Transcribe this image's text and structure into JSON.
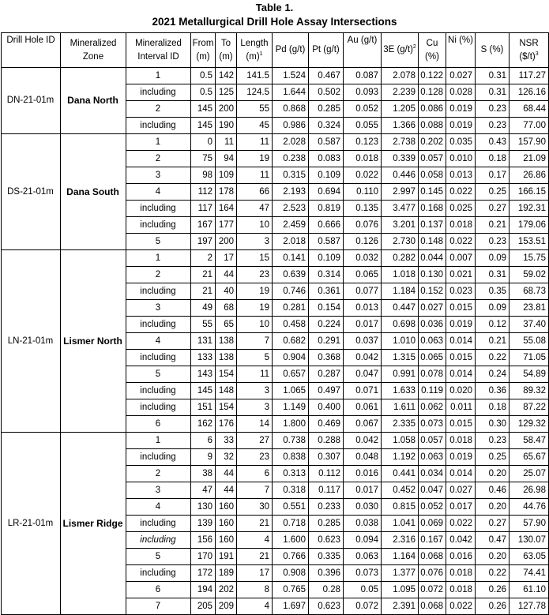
{
  "title_line1": "Table 1.",
  "title_line2": "2021 Metallurgical Drill Hole Assay Intersections",
  "headers": {
    "hole": "Drill Hole ID",
    "zone": "Mineralized Zone",
    "interval": "Mineralized Interval ID",
    "from": "From (m)",
    "to": "To (m)",
    "length": "Length (m)",
    "length_sup": "1",
    "pd": "Pd (g/t)",
    "pt": "Pt (g/t)",
    "au": "Au (g/t)",
    "e3": "3E (g/t)",
    "e3_sup": "2",
    "cu": "Cu (%)",
    "ni": "Ni (%)",
    "s": "S (%)",
    "nsr": "NSR ($/t)",
    "nsr_sup": "3"
  },
  "groups": [
    {
      "hole": "DN-21-01m",
      "zone": "Dana North",
      "rows": [
        [
          "1",
          "0.5",
          "142",
          "141.5",
          "1.524",
          "0.467",
          "0.087",
          "2.078",
          "0.122",
          "0.027",
          "0.31",
          "117.27"
        ],
        [
          "including",
          "0.5",
          "125",
          "124.5",
          "1.644",
          "0.502",
          "0.093",
          "2.239",
          "0.128",
          "0.028",
          "0.31",
          "126.16"
        ],
        [
          "2",
          "145",
          "200",
          "55",
          "0.868",
          "0.285",
          "0.052",
          "1.205",
          "0.086",
          "0.019",
          "0.23",
          "68.44"
        ],
        [
          "including",
          "145",
          "190",
          "45",
          "0.986",
          "0.324",
          "0.055",
          "1.366",
          "0.088",
          "0.019",
          "0.23",
          "77.00"
        ]
      ]
    },
    {
      "hole": "DS-21-01m",
      "zone": "Dana South",
      "rows": [
        [
          "1",
          "0",
          "11",
          "11",
          "2.028",
          "0.587",
          "0.123",
          "2.738",
          "0.202",
          "0.035",
          "0.43",
          "157.90"
        ],
        [
          "2",
          "75",
          "94",
          "19",
          "0.238",
          "0.083",
          "0.018",
          "0.339",
          "0.057",
          "0.010",
          "0.18",
          "21.09"
        ],
        [
          "3",
          "98",
          "109",
          "11",
          "0.315",
          "0.109",
          "0.022",
          "0.446",
          "0.058",
          "0.013",
          "0.17",
          "26.86"
        ],
        [
          "4",
          "112",
          "178",
          "66",
          "2.193",
          "0.694",
          "0.110",
          "2.997",
          "0.145",
          "0.022",
          "0.25",
          "166.15"
        ],
        [
          "including",
          "117",
          "164",
          "47",
          "2.523",
          "0.819",
          "0.135",
          "3.477",
          "0.168",
          "0.025",
          "0.27",
          "192.31"
        ],
        [
          "including",
          "167",
          "177",
          "10",
          "2.459",
          "0.666",
          "0.076",
          "3.201",
          "0.137",
          "0.018",
          "0.21",
          "179.06"
        ],
        [
          "5",
          "197",
          "200",
          "3",
          "2.018",
          "0.587",
          "0.126",
          "2.730",
          "0.148",
          "0.022",
          "0.23",
          "153.51"
        ]
      ]
    },
    {
      "hole": "LN-21-01m",
      "zone": "Lismer North",
      "rows": [
        [
          "1",
          "2",
          "17",
          "15",
          "0.141",
          "0.109",
          "0.032",
          "0.282",
          "0.044",
          "0.007",
          "0.09",
          "15.75"
        ],
        [
          "2",
          "21",
          "44",
          "23",
          "0.639",
          "0.314",
          "0.065",
          "1.018",
          "0.130",
          "0.021",
          "0.31",
          "59.02"
        ],
        [
          "including",
          "21",
          "40",
          "19",
          "0.746",
          "0.361",
          "0.077",
          "1.184",
          "0.152",
          "0.023",
          "0.35",
          "68.73"
        ],
        [
          "3",
          "49",
          "68",
          "19",
          "0.281",
          "0.154",
          "0.013",
          "0.447",
          "0.027",
          "0.015",
          "0.09",
          "23.81"
        ],
        [
          "including",
          "55",
          "65",
          "10",
          "0.458",
          "0.224",
          "0.017",
          "0.698",
          "0.036",
          "0.019",
          "0.12",
          "37.40"
        ],
        [
          "4",
          "131",
          "138",
          "7",
          "0.682",
          "0.291",
          "0.037",
          "1.010",
          "0.063",
          "0.014",
          "0.21",
          "55.08"
        ],
        [
          "including",
          "133",
          "138",
          "5",
          "0.904",
          "0.368",
          "0.042",
          "1.315",
          "0.065",
          "0.015",
          "0.22",
          "71.05"
        ],
        [
          "5",
          "143",
          "154",
          "11",
          "0.657",
          "0.287",
          "0.047",
          "0.991",
          "0.078",
          "0.014",
          "0.24",
          "54.89"
        ],
        [
          "including",
          "145",
          "148",
          "3",
          "1.065",
          "0.497",
          "0.071",
          "1.633",
          "0.119",
          "0.020",
          "0.36",
          "89.32"
        ],
        [
          "including",
          "151",
          "154",
          "3",
          "1.149",
          "0.400",
          "0.061",
          "1.611",
          "0.062",
          "0.011",
          "0.18",
          "87.22"
        ],
        [
          "6",
          "162",
          "176",
          "14",
          "1.800",
          "0.469",
          "0.067",
          "2.335",
          "0.073",
          "0.015",
          "0.30",
          "129.32"
        ]
      ]
    },
    {
      "hole": "LR-21-01m",
      "zone": "Lismer Ridge",
      "rows": [
        [
          "1",
          "6",
          "33",
          "27",
          "0.738",
          "0.288",
          "0.042",
          "1.058",
          "0.057",
          "0.018",
          "0.23",
          "58.47"
        ],
        [
          "including",
          "9",
          "32",
          "23",
          "0.838",
          "0.307",
          "0.048",
          "1.192",
          "0.063",
          "0.019",
          "0.25",
          "65.67"
        ],
        [
          "2",
          "38",
          "44",
          "6",
          "0.313",
          "0.112",
          "0.016",
          "0.441",
          "0.034",
          "0.014",
          "0.20",
          "25.07"
        ],
        [
          "3",
          "47",
          "44",
          "7",
          "0.318",
          "0.117",
          "0.017",
          "0.452",
          "0.047",
          "0.027",
          "0.46",
          "26.98"
        ],
        [
          "4",
          "130",
          "160",
          "30",
          "0.551",
          "0.233",
          "0.030",
          "0.815",
          "0.052",
          "0.017",
          "0.20",
          "44.76"
        ],
        [
          "including",
          "139",
          "160",
          "21",
          "0.718",
          "0.285",
          "0.038",
          "1.041",
          "0.069",
          "0.022",
          "0.27",
          "57.90"
        ],
        [
          "including",
          "156",
          "160",
          "4",
          "1.600",
          "0.623",
          "0.094",
          "2.316",
          "0.167",
          "0.042",
          "0.47",
          "130.07"
        ],
        [
          "5",
          "170",
          "191",
          "21",
          "0.766",
          "0.335",
          "0.063",
          "1.164",
          "0.068",
          "0.016",
          "0.20",
          "63.05"
        ],
        [
          "including",
          "172",
          "189",
          "17",
          "0.908",
          "0.396",
          "0.073",
          "1.377",
          "0.076",
          "0.018",
          "0.22",
          "74.41"
        ],
        [
          "6",
          "194",
          "202",
          "8",
          "0.765",
          "0.28",
          "0.05",
          "1.095",
          "0.072",
          "0.018",
          "0.26",
          "61.10"
        ],
        [
          "7",
          "205",
          "209",
          "4",
          "1.697",
          "0.623",
          "0.072",
          "2.391",
          "0.068",
          "0.022",
          "0.26",
          "127.78"
        ]
      ]
    }
  ],
  "italic_rows": [
    [
      3,
      6
    ]
  ]
}
